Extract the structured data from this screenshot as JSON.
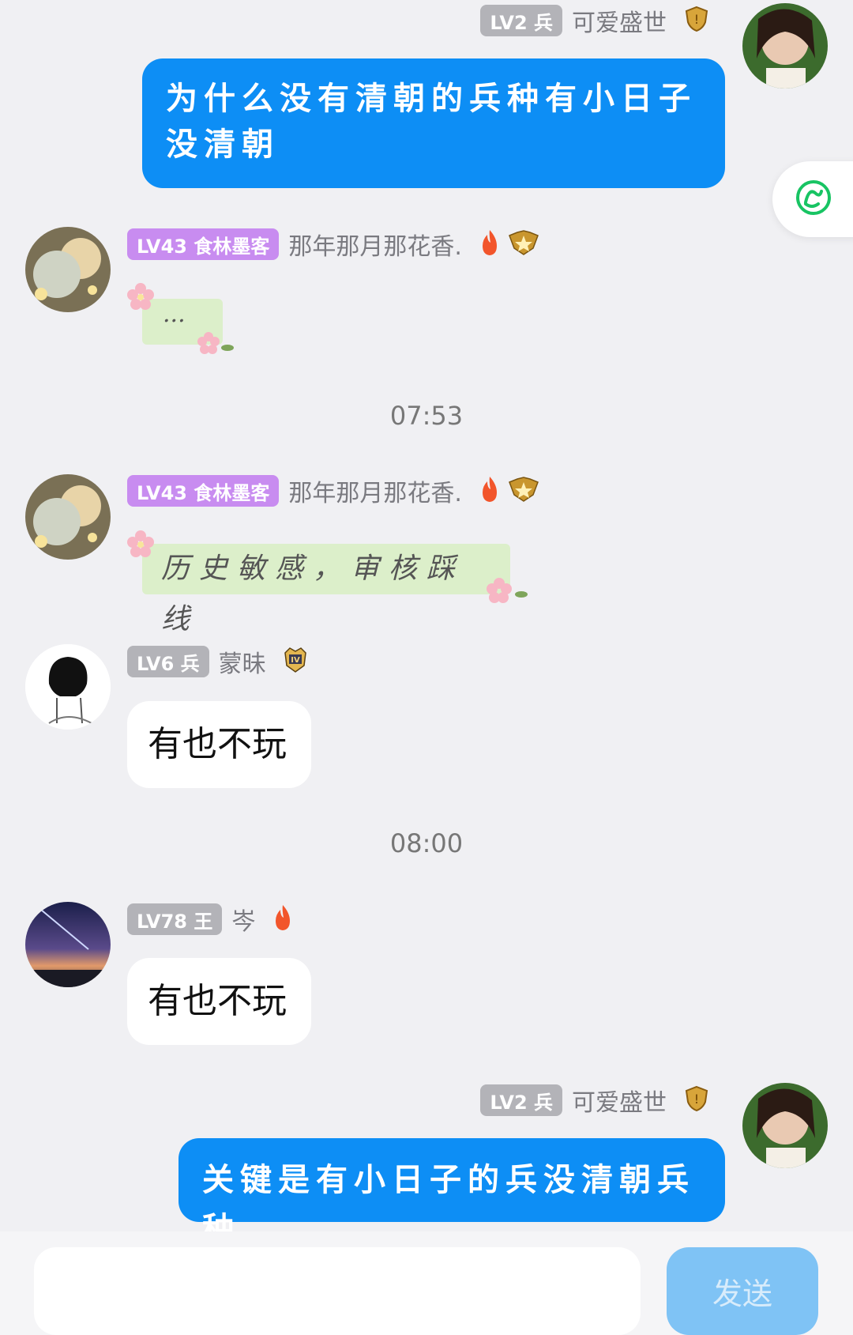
{
  "messages": {
    "m1": {
      "level": "LV2 兵",
      "nick": "可爱盛世",
      "text": "为什么没有清朝的兵种有小日子没清朝"
    },
    "m2": {
      "level": "LV43 食林墨客",
      "nick": "那年那月那花香.",
      "text": "..."
    },
    "time1": "07:53",
    "m3": {
      "level": "LV43 食林墨客",
      "nick": "那年那月那花香.",
      "text": "历史敏感，审核踩线"
    },
    "m4": {
      "level": "LV6 兵",
      "nick": "蒙昧",
      "text": "有也不玩"
    },
    "time2": "08:00",
    "m5": {
      "level": "LV78 王",
      "nick": "岑",
      "text": "有也不玩"
    },
    "m6": {
      "level": "LV2 兵",
      "nick": "可爱盛世",
      "text": "关键是有小日子的兵没清朝兵种"
    }
  },
  "input": {
    "value": "",
    "send_label": "发送"
  },
  "icons": {
    "side": "swirl-icon",
    "fire": "fire-icon",
    "shield": "shield-badge-icon",
    "star": "star-badge-icon",
    "rank": "rank-iv-badge-icon"
  },
  "colors": {
    "accent": "#0d8ef5",
    "purple_badge": "#c88cf0",
    "grey_badge": "#b3b3b8",
    "send": "#7fc3f5"
  }
}
